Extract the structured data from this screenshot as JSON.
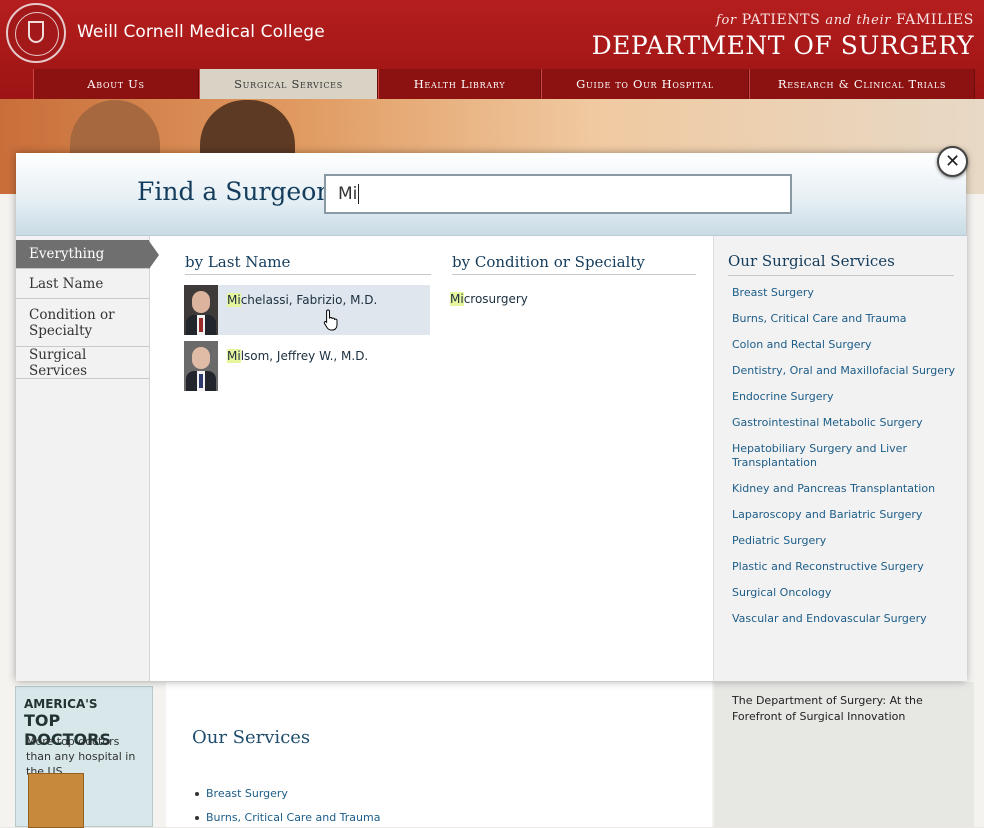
{
  "header": {
    "college": "Weill Cornell Medical College",
    "tagline_for": "for",
    "tagline_patients": "PATIENTS",
    "tagline_and_their": "and their",
    "tagline_families": "FAMILIES",
    "department": "DEPARTMENT OF SURGERY",
    "nav": [
      "About Us",
      "Surgical Services",
      "Health Library",
      "Guide to Our Hospital",
      "Research & Clinical Trials"
    ],
    "active_nav": "Surgical Services"
  },
  "colors": {
    "brand_red": "#a51a1a",
    "navy": "#143c5c",
    "link_blue": "#1d5d88",
    "highlight": "#e7f59c"
  },
  "background_page": {
    "ad_line1": "AMERICA'S",
    "ad_line2": "TOP DOCTORS",
    "ad_line3": "More top doctors than any hospital in the US.",
    "our_services": "Our Services",
    "services": [
      "Breast Surgery",
      "Burns, Critical Care and Trauma"
    ],
    "right_text": "The Department of Surgery: At the Forefront of Surgical Innovation"
  },
  "modal": {
    "title": "Find a Surgeon",
    "search_value": "Mi",
    "close_icon": "close-icon",
    "sidebar": [
      "Everything",
      "Last Name",
      "Condition or Specialty",
      "Surgical Services"
    ],
    "sidebar_active": "Everything",
    "col_last_name": "by Last Name",
    "col_condition": "by Condition or Specialty",
    "col_services": "Our Surgical Services",
    "last_name_results": [
      {
        "match": "Mi",
        "rest": "chelassi, Fabrizio, M.D."
      },
      {
        "match": "Mi",
        "rest": "lsom, Jeffrey W., M.D."
      }
    ],
    "condition_results": [
      {
        "match": "Mi",
        "rest": "crosurgery"
      }
    ],
    "surgical_services": [
      "Breast Surgery",
      "Burns, Critical Care and Trauma",
      "Colon and Rectal Surgery",
      "Dentistry, Oral and Maxillofacial Surgery",
      "Endocrine Surgery",
      "Gastrointestinal Metabolic Surgery",
      "Hepatobiliary Surgery and Liver Transplantation",
      "Kidney and Pancreas Transplantation",
      "Laparoscopy and Bariatric Surgery",
      "Pediatric Surgery",
      "Plastic and Reconstructive Surgery",
      "Surgical Oncology",
      "Vascular and Endovascular Surgery"
    ]
  }
}
